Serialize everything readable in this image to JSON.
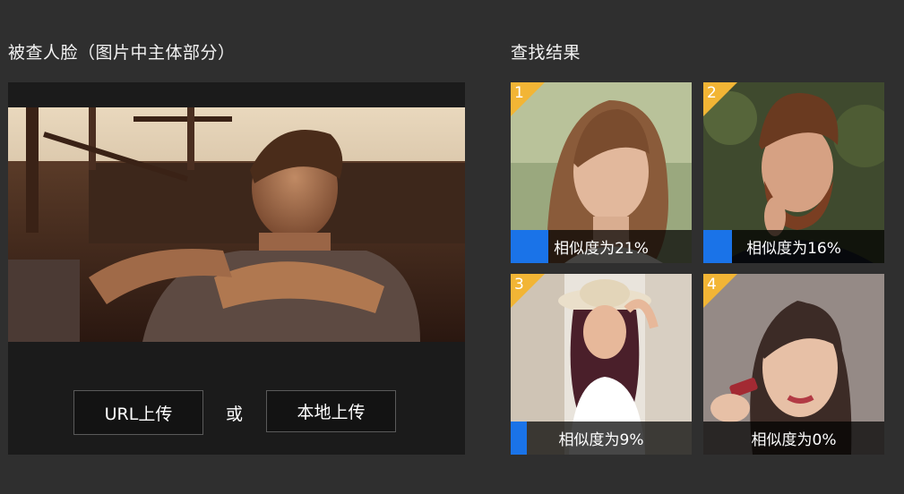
{
  "left_panel": {
    "title": "被查人脸（图片中主体部分）",
    "url_upload_label": "URL上传",
    "or_label": "或",
    "local_upload_label": "本地上传"
  },
  "right_panel": {
    "title": "查找结果",
    "results": [
      {
        "rank": "1",
        "similarity_label": "相似度为21%",
        "similarity": 0.21
      },
      {
        "rank": "2",
        "similarity_label": "相似度为16%",
        "similarity": 0.16
      },
      {
        "rank": "3",
        "similarity_label": "相似度为9%",
        "similarity": 0.09
      },
      {
        "rank": "4",
        "similarity_label": "相似度为0%",
        "similarity": 0.0
      }
    ]
  },
  "colors": {
    "background": "#2f2f2f",
    "panel": "#1b1b1b",
    "similarity_bar": "#1a73e8",
    "rank_badge": "#f2b535"
  }
}
